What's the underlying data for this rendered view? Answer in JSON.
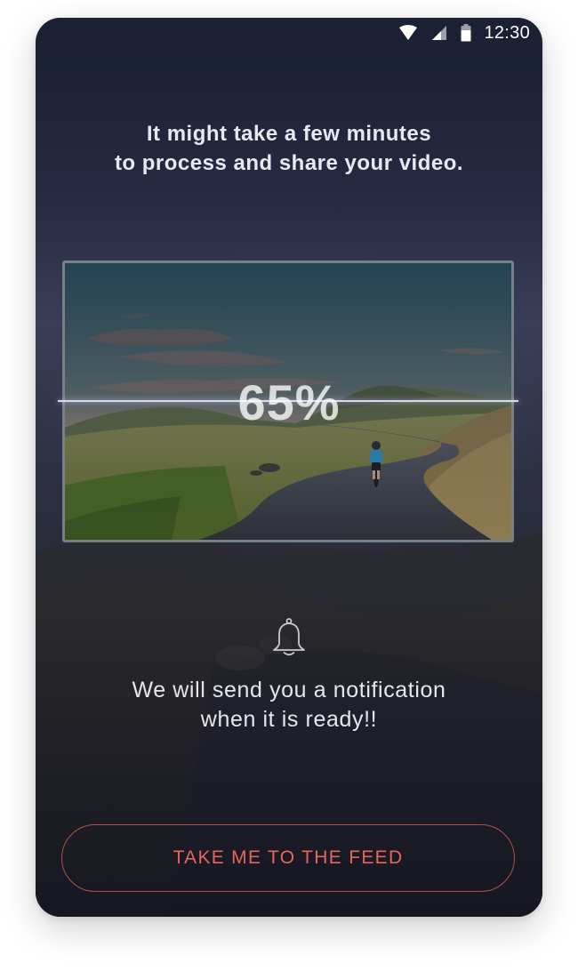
{
  "status_bar": {
    "time": "12:30",
    "icons": [
      "wifi-icon",
      "cell-signal-icon",
      "battery-icon"
    ]
  },
  "message": {
    "line1": "It might take a few minutes",
    "line2": "to process and share your video."
  },
  "upload": {
    "progress_label": "65%",
    "progress": 0.65
  },
  "notification": {
    "icon": "bell-icon",
    "line1": "We will send you a notification",
    "line2": "when it is ready!!"
  },
  "actions": {
    "feed_label": "TAKE ME TO THE FEED"
  },
  "colors": {
    "background": "#1e2133",
    "text": "#e8e9ee",
    "accent": "#e7665c",
    "progress_line": "#d8dcf2"
  }
}
